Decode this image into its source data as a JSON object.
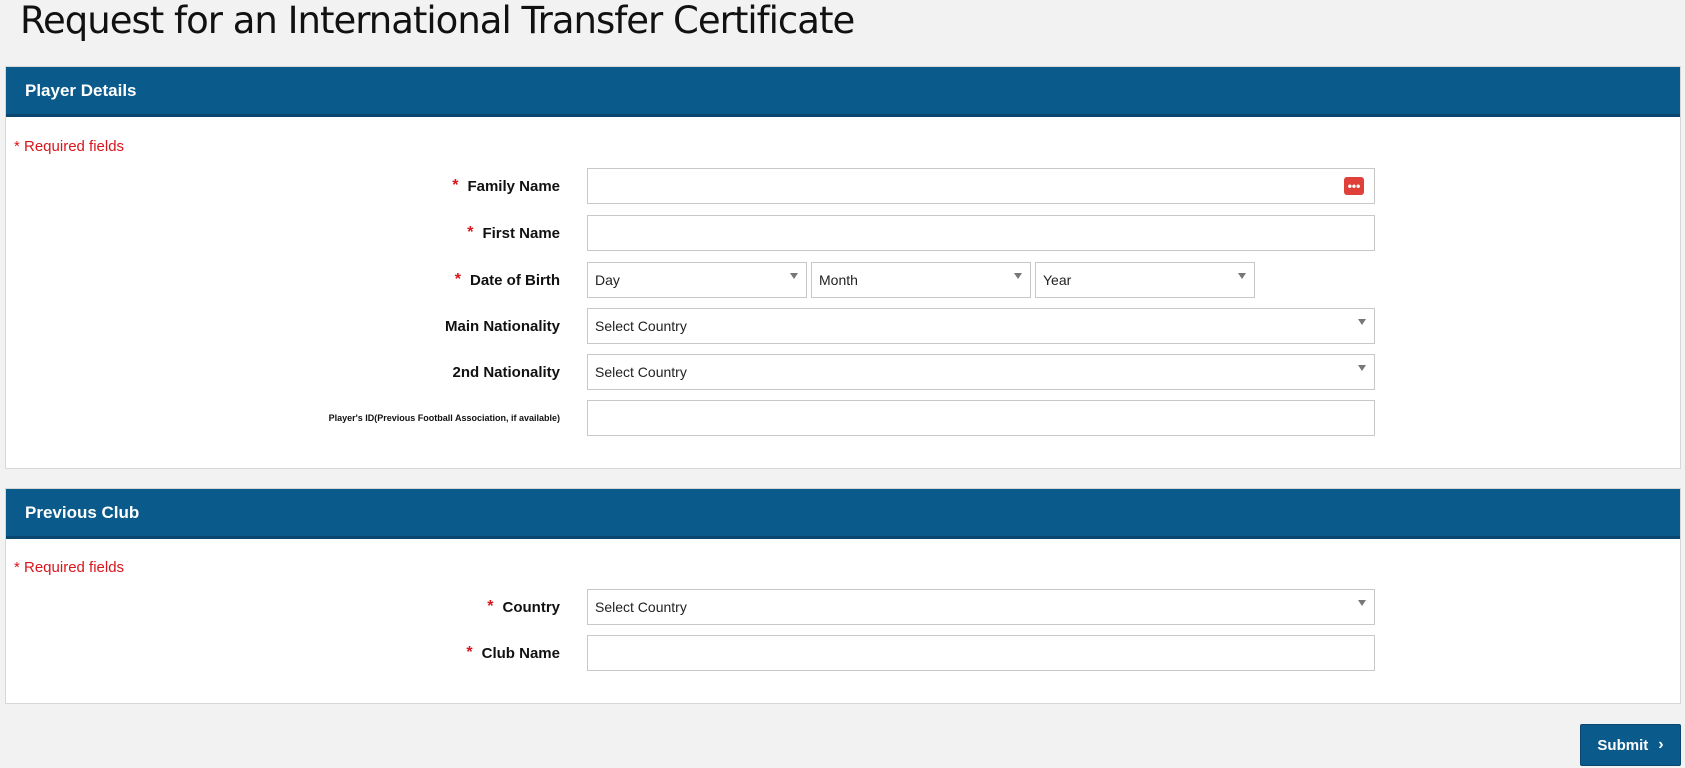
{
  "page": {
    "title": "Request for an International Transfer Certificate"
  },
  "player_details": {
    "header": "Player Details",
    "required_note": "* Required fields",
    "fields": {
      "family_name": {
        "label": "Family Name",
        "required": "*",
        "value": ""
      },
      "first_name": {
        "label": "First Name",
        "required": "*",
        "value": ""
      },
      "dob": {
        "label": "Date of Birth",
        "required": "*",
        "day": "Day",
        "month": "Month",
        "year": "Year"
      },
      "main_nationality": {
        "label": "Main Nationality",
        "selected": "Select Country"
      },
      "second_nationality": {
        "label": "2nd Nationality",
        "selected": "Select Country"
      },
      "player_id": {
        "label": "Player's ID(Previous Football Association, if available)",
        "value": ""
      }
    },
    "family_name_icon": "more-dots-icon"
  },
  "previous_club": {
    "header": "Previous Club",
    "required_note": "* Required fields",
    "fields": {
      "country": {
        "label": "Country",
        "required": "*",
        "selected": "Select Country"
      },
      "club_name": {
        "label": "Club Name",
        "required": "*",
        "value": ""
      }
    }
  },
  "actions": {
    "submit": "Submit",
    "submit_icon": "chevron-right-icon"
  },
  "colors": {
    "header_bg": "#0a5a8c",
    "required": "#d8151c",
    "icon_red": "#e0403a"
  }
}
